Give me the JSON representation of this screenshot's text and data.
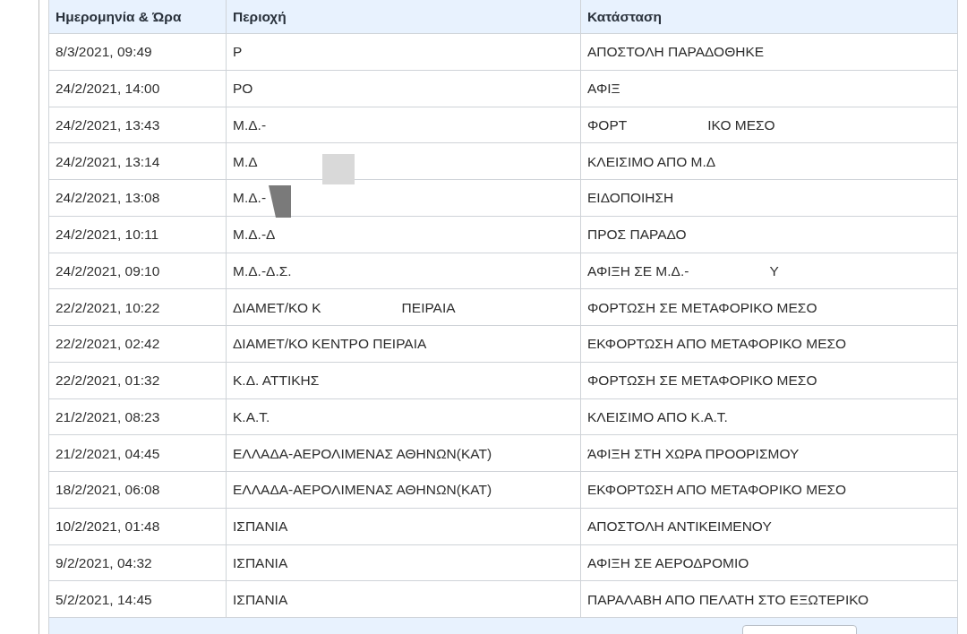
{
  "table": {
    "columns": [
      "Ημερομηνία & Ώρα",
      "Περιοχή",
      "Κατάσταση"
    ],
    "rows": [
      {
        "datetime": "8/3/2021, 09:49",
        "region": [
          "Ρ"
        ],
        "status": [
          "ΑΠΟΣΤΟΛΗ ΠΑΡΑΔΟΘΗΚΕ"
        ]
      },
      {
        "datetime": "24/2/2021, 14:00",
        "region": [
          "ΡΟ"
        ],
        "status": [
          "ΑΦΙΞ"
        ]
      },
      {
        "datetime": "24/2/2021, 13:43",
        "region": [
          "Μ.Δ.-"
        ],
        "status": [
          "ΦΟΡΤ",
          "ΙΚΟ ΜΕΣΟ"
        ]
      },
      {
        "datetime": "24/2/2021, 13:14",
        "region": [
          "Μ.Δ"
        ],
        "status": [
          "ΚΛΕΙΣΙΜΟ ΑΠΟ Μ.Δ"
        ]
      },
      {
        "datetime": "24/2/2021, 13:08",
        "region": [
          "Μ.Δ.-"
        ],
        "status": [
          "ΕΙΔΟΠΟΙΗΣΗ"
        ]
      },
      {
        "datetime": "24/2/2021, 10:11",
        "region": [
          "Μ.Δ.-Δ"
        ],
        "status": [
          "ΠΡΟΣ ΠΑΡΑΔΟ"
        ]
      },
      {
        "datetime": "24/2/2021, 09:10",
        "region": [
          "Μ.Δ.-Δ.Σ."
        ],
        "status": [
          "ΑΦΙΞΗ ΣΕ Μ.Δ.-",
          "Υ"
        ]
      },
      {
        "datetime": "22/2/2021, 10:22",
        "region": [
          "ΔΙΑΜΕΤ/ΚΟ Κ",
          "ΠΕΙΡΑΙΑ"
        ],
        "status": [
          "ΦΟΡΤΩΣΗ ΣΕ ΜΕΤΑΦΟΡΙΚΟ ΜΕΣΟ"
        ]
      },
      {
        "datetime": "22/2/2021, 02:42",
        "region": [
          "ΔΙΑΜΕΤ/ΚΟ ΚΕΝΤΡΟ ΠΕΙΡΑΙΑ"
        ],
        "status": [
          "ΕΚΦΟΡΤΩΣΗ ΑΠΟ ΜΕΤΑΦΟΡΙΚΟ ΜΕΣΟ"
        ]
      },
      {
        "datetime": "22/2/2021, 01:32",
        "region": [
          "Κ.Δ. ΑΤΤΙΚΗΣ"
        ],
        "status": [
          "ΦΟΡΤΩΣΗ ΣΕ ΜΕΤΑΦΟΡΙΚΟ ΜΕΣΟ"
        ]
      },
      {
        "datetime": "21/2/2021, 08:23",
        "region": [
          "Κ.Α.Τ."
        ],
        "status": [
          "ΚΛΕΙΣΙΜΟ ΑΠΟ Κ.Α.Τ."
        ]
      },
      {
        "datetime": "21/2/2021, 04:45",
        "region": [
          "ΕΛΛΑΔΑ-ΑΕΡΟΛΙΜΕΝΑΣ ΑΘΗΝΩΝ(ΚΑΤ)"
        ],
        "status": [
          "ΆΦΙΞΗ ΣΤΗ ΧΩΡΑ ΠΡΟΟΡΙΣΜΟΥ"
        ]
      },
      {
        "datetime": "18/2/2021, 06:08",
        "region": [
          "ΕΛΛΑΔΑ-ΑΕΡΟΛΙΜΕΝΑΣ ΑΘΗΝΩΝ(ΚΑΤ)"
        ],
        "status": [
          "ΕΚΦΟΡΤΩΣΗ ΑΠΟ ΜΕΤΑΦΟΡΙΚΟ ΜΕΣΟ"
        ]
      },
      {
        "datetime": "10/2/2021, 01:48",
        "region": [
          "ΙΣΠΑΝΙΑ"
        ],
        "status": [
          "ΑΠΟΣΤΟΛΗ ΑΝΤΙΚΕΙΜΕΝΟΥ"
        ]
      },
      {
        "datetime": "9/2/2021, 04:32",
        "region": [
          "ΙΣΠΑΝΙΑ"
        ],
        "status": [
          "ΑΦΙΞΗ ΣΕ ΑΕΡΟΔΡΟΜΙΟ"
        ]
      },
      {
        "datetime": "5/2/2021, 14:45",
        "region": [
          "ΙΣΠΑΝΙΑ"
        ],
        "status": [
          "ΠΑΡΑΛΑΒΗ ΑΠΟ ΠΕΛΑΤΗ ΣΤΟ ΕΞΩΤΕΡΙΚΟ"
        ]
      }
    ]
  }
}
